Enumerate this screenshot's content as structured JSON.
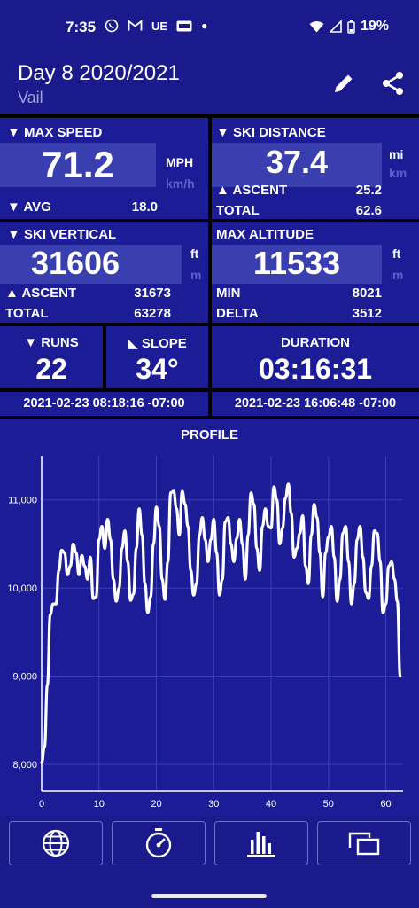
{
  "status_bar": {
    "time": "7:35",
    "carrier_tags": [
      "UE"
    ],
    "battery": "19%"
  },
  "header": {
    "title": "Day 8 2020/2021",
    "subtitle": "Vail",
    "edit_icon": "pencil-icon",
    "share_icon": "share-icon"
  },
  "max_speed": {
    "label": "▼ MAX SPEED",
    "value": "71.2",
    "unit_primary": "MPH",
    "unit_secondary": "km/h",
    "avg_label": "▼ AVG",
    "avg_value": "18.0"
  },
  "ski_distance": {
    "label": "▼ SKI DISTANCE",
    "value": "37.4",
    "unit_primary": "mi",
    "unit_secondary": "km",
    "ascent_label": "▲ ASCENT",
    "ascent_value": "25.2",
    "total_label": "TOTAL",
    "total_value": "62.6"
  },
  "ski_vertical": {
    "label": "▼ SKI VERTICAL",
    "value": "31606",
    "unit_primary": "ft",
    "unit_secondary": "m",
    "ascent_label": "▲ ASCENT",
    "ascent_value": "31673",
    "total_label": "TOTAL",
    "total_value": "63278"
  },
  "max_altitude": {
    "label": "MAX ALTITUDE",
    "value": "11533",
    "unit_primary": "ft",
    "unit_secondary": "m",
    "min_label": "MIN",
    "min_value": "8021",
    "delta_label": "DELTA",
    "delta_value": "3512"
  },
  "runs": {
    "label": "▼ RUNS",
    "value": "22"
  },
  "slope": {
    "label": "◣ SLOPE",
    "value": "34°"
  },
  "duration": {
    "label": "DURATION",
    "value": "03:16:31"
  },
  "start_time": "2021-02-23 08:18:16 -07:00",
  "end_time": "2021-02-23 16:06:48 -07:00",
  "chart_data": {
    "type": "line",
    "title": "PROFILE",
    "xlim": [
      0,
      63
    ],
    "ylim": [
      7700,
      11500
    ],
    "x_ticks": [
      0,
      10,
      20,
      30,
      40,
      50,
      60
    ],
    "y_ticks": [
      "8,000",
      "9,000",
      "10,000",
      "11,000"
    ],
    "y_tick_values": [
      8000,
      9000,
      10000,
      11000
    ],
    "grid": true,
    "series": [
      {
        "x": [
          0,
          0.5,
          1,
          1.5,
          2,
          2.5,
          3,
          3.5,
          4,
          4.5,
          5,
          5.5,
          6,
          6.5,
          7,
          7.5,
          8,
          8.5,
          9,
          9.5,
          10,
          10.5,
          11,
          11.5,
          12,
          12.5,
          13,
          13.5,
          14,
          14.5,
          15,
          15.5,
          16,
          16.5,
          17,
          17.5,
          18,
          18.5,
          19,
          19.5,
          20,
          20.5,
          21,
          21.5,
          22,
          22.5,
          23,
          23.5,
          24,
          24.5,
          25,
          25.5,
          26,
          26.5,
          27,
          27.5,
          28,
          28.5,
          29,
          29.5,
          30,
          30.5,
          31,
          31.5,
          32,
          32.5,
          33,
          33.5,
          34,
          34.5,
          35,
          35.5,
          36,
          36.5,
          37,
          37.5,
          38,
          38.5,
          39,
          39.5,
          40,
          40.5,
          41,
          41.5,
          42,
          42.5,
          43,
          43.5,
          44,
          44.5,
          45,
          45.5,
          46,
          46.5,
          47,
          47.5,
          48,
          48.5,
          49,
          49.5,
          50,
          50.5,
          51,
          51.5,
          52,
          52.5,
          53,
          53.5,
          54,
          54.5,
          55,
          55.5,
          56,
          56.5,
          57,
          57.5,
          58,
          58.5,
          59,
          59.5,
          60,
          60.5,
          61,
          61.5,
          62,
          62.5
        ],
        "y": [
          8020,
          8200,
          8900,
          9700,
          9820,
          9820,
          10200,
          10430,
          10400,
          10150,
          10250,
          10500,
          10400,
          10150,
          10370,
          10250,
          10100,
          10350,
          9880,
          9900,
          10550,
          10700,
          10450,
          10780,
          10550,
          10100,
          9850,
          10000,
          10450,
          10650,
          10300,
          9860,
          9930,
          10450,
          10900,
          10600,
          10050,
          9720,
          9900,
          10500,
          10920,
          10700,
          10100,
          9870,
          10300,
          11080,
          11100,
          10900,
          10600,
          11100,
          10950,
          10700,
          10200,
          9920,
          10050,
          10600,
          10800,
          10550,
          10300,
          10550,
          10780,
          10400,
          9920,
          10100,
          10750,
          10800,
          10500,
          10300,
          10560,
          10780,
          10500,
          10100,
          10600,
          11080,
          10950,
          10450,
          10200,
          10700,
          10900,
          10700,
          10680,
          11150,
          11000,
          10500,
          10680,
          11020,
          11180,
          10850,
          10350,
          10450,
          10620,
          10820,
          10250,
          10050,
          10600,
          10950,
          10800,
          10400,
          9900,
          10400,
          10580,
          10700,
          10350,
          9850,
          10100,
          10620,
          10700,
          10300,
          9820,
          10050,
          10550,
          10700,
          10350,
          9950,
          9880,
          10250,
          10650,
          10620,
          10300,
          9720,
          9820,
          10250,
          10300,
          10100,
          9850,
          9000
        ]
      }
    ]
  },
  "nav": [
    {
      "icon": "globe-icon"
    },
    {
      "icon": "stopwatch-icon"
    },
    {
      "icon": "bar-chart-icon"
    },
    {
      "icon": "cards-icon"
    }
  ]
}
